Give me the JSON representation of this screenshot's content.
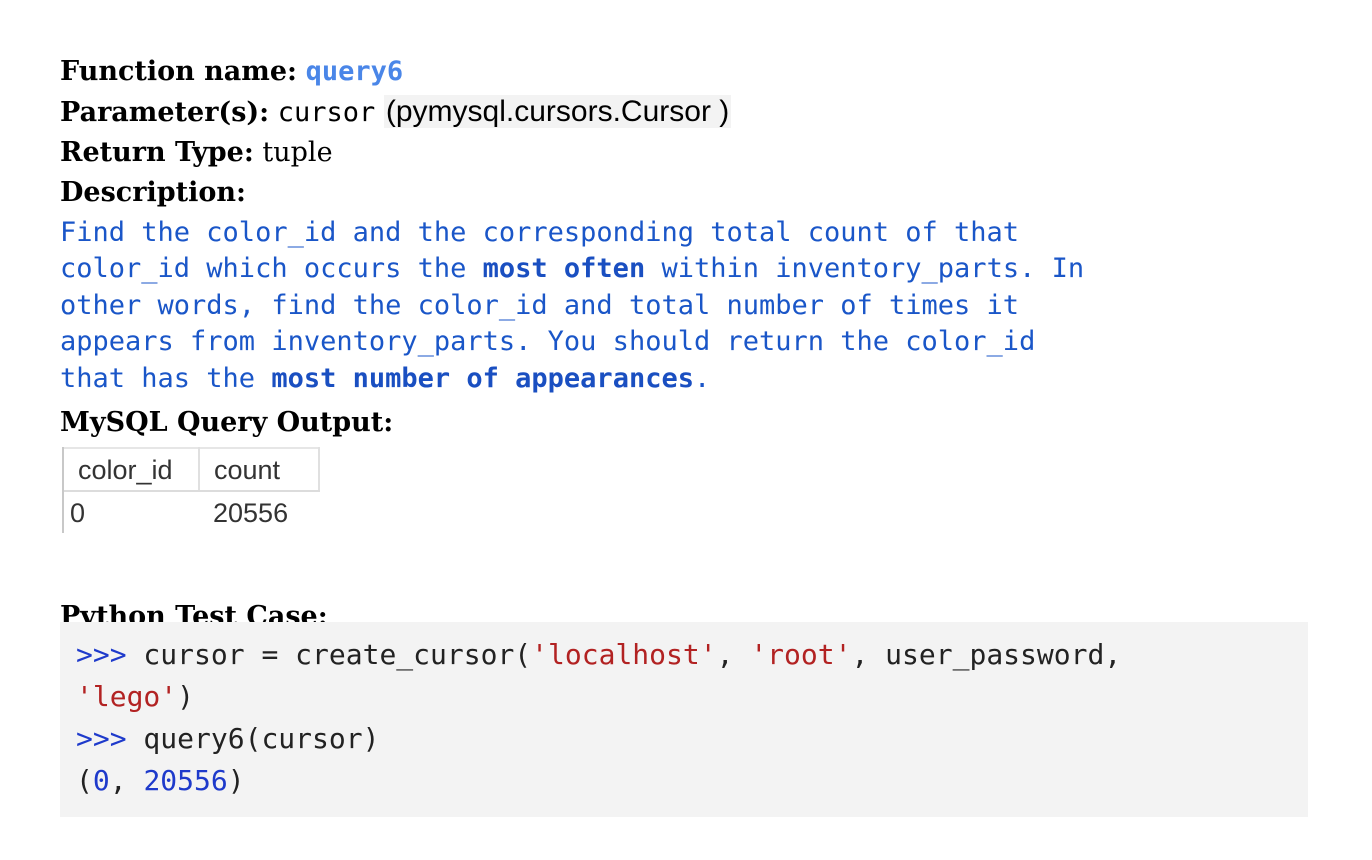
{
  "header": {
    "function_label": "Function name:",
    "function_name": "query6",
    "parameters_label": "Parameter(s):",
    "parameter_name": "cursor",
    "parameter_open": "(",
    "parameter_type": "pymysql.cursors.Cursor",
    "parameter_close": ")",
    "return_label": "Return Type:",
    "return_type": "tuple",
    "description_label": "Description:"
  },
  "description": {
    "p1": "Find the color_id and the corresponding total count of that",
    "p2a": "color_id which occurs the ",
    "p2b": "most often",
    "p2c": " within inventory_parts. In",
    "p3": "other words, find the color_id and total number of times it",
    "p4": "appears from inventory_parts. You should return the color_id",
    "p5a": "that has the ",
    "p5b": "most number of appearances",
    "p5c": "."
  },
  "output": {
    "label": "MySQL Query Output:",
    "columns": [
      "color_id",
      "count"
    ],
    "rows": [
      [
        "0",
        "20556"
      ]
    ]
  },
  "test": {
    "label": "Python Test Case:",
    "prompt": ">>>",
    "line1_a": " cursor = create_cursor(",
    "line1_s1": "'localhost'",
    "line1_c1": ", ",
    "line1_s2": "'root'",
    "line1_b": ", user_password,",
    "line2_s": "'lego'",
    "line2_b": ")",
    "line3": " query6(cursor)",
    "line4_a": "(",
    "line4_n1": "0",
    "line4_b": ", ",
    "line4_n2": "20556",
    "line4_c": ")"
  }
}
